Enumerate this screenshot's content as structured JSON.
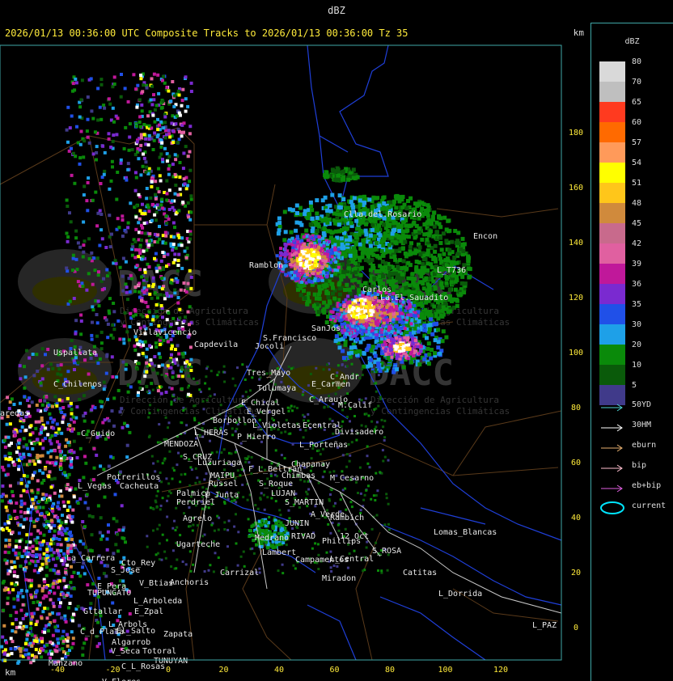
{
  "window_title": "dBZ",
  "headline": "2026/01/13 00:36:00 UTC Composite Tracks to 2026/01/13 00:36:00 Tz 35",
  "unit_label": "km",
  "legend": {
    "title": "dBZ",
    "scale": [
      {
        "value": "80",
        "color": "#d9d9d9"
      },
      {
        "value": "70",
        "color": "#bfbfbf"
      },
      {
        "value": "65",
        "color": "#ff3a1f"
      },
      {
        "value": "60",
        "color": "#ff6a00"
      },
      {
        "value": "57",
        "color": "#ff9a5a"
      },
      {
        "value": "54",
        "color": "#ffff00"
      },
      {
        "value": "51",
        "color": "#ffc61a"
      },
      {
        "value": "48",
        "color": "#d08a3c"
      },
      {
        "value": "45",
        "color": "#c86a8c"
      },
      {
        "value": "42",
        "color": "#e060a0"
      },
      {
        "value": "39",
        "color": "#c0189a"
      },
      {
        "value": "36",
        "color": "#7a2ad0"
      },
      {
        "value": "35",
        "color": "#2050e8"
      },
      {
        "value": "30",
        "color": "#1ea0e8"
      },
      {
        "value": "20",
        "color": "#0a8a0a"
      },
      {
        "value": "10",
        "color": "#0a5a0a"
      },
      {
        "value": "5",
        "color": "#403a8a"
      }
    ],
    "tracks": [
      {
        "label": "50YD",
        "color": "#4fd3d3"
      },
      {
        "label": "30HM",
        "color": "#ffffff"
      },
      {
        "label": "eburn",
        "color": "#e8b070"
      },
      {
        "label": "bip",
        "color": "#ffc0d0"
      },
      {
        "label": "eb+bip",
        "color": "#e060e0"
      },
      {
        "label": "current",
        "color": "#00e5ff",
        "icon": "ellipse"
      }
    ]
  },
  "map": {
    "y_ticks": [
      "180",
      "160",
      "140",
      "120",
      "100",
      "80",
      "60",
      "40",
      "20",
      "0"
    ],
    "x_ticks": [
      "-40",
      "-20",
      "0",
      "20",
      "40",
      "60",
      "80",
      "100",
      "120"
    ],
    "watermark": {
      "brand": "DACC",
      "line1": "Dirección de Agricultura",
      "line2": "y Contingencias Climáticas"
    },
    "places": [
      "Clla.del.Rosario",
      "Encon",
      "Ramblon",
      "L_T736",
      "Carlos",
      "La.El.Sauadito",
      "S.Francisco",
      "Villavicencio",
      "Capdevila",
      "Jocoli",
      "SanJos",
      "Uspallata",
      "Tres_Mayo",
      "Tulumaya",
      "C_Andr",
      "E_Carmen",
      "C_Chilenos",
      "E_Chical",
      "E_Vergel",
      "C_Araujo",
      "M.Calif",
      "Borbollon",
      "Ecentral",
      "Divisadero",
      "aredas",
      "C_Guido",
      "L_HERAS",
      "P_Hierro",
      "L_Violetas",
      "MENDOZA",
      "L_Porteñas",
      "S_CRUZ",
      "Luzuriaga",
      "F_L_Beltran",
      "Chapanay",
      "Potrerillos",
      "MAIPU",
      "Chimbas",
      "M_Cesarno",
      "L_Vegas",
      "Cacheuta",
      "Russel",
      "S_Roque",
      "LUJAN",
      "Palmica",
      "Perdriel",
      "L_Junta",
      "S_MARTIN",
      "A_Verde",
      "Agrelo",
      "JUNIN",
      "Rambich",
      "Lomas_Blancas",
      "Ugarteche",
      "RIVAD",
      "12_Oct",
      "La_Carrera",
      "Cto_Rey",
      "S_Jose",
      "Phillips",
      "S_ROSA",
      "Carrizal",
      "Medrano",
      "Catitas",
      "L_Central",
      "E_Pera",
      "Anchoris",
      "V_Btias",
      "TUPUNGATO",
      "Miradon",
      "L_Arboleda",
      "L_Dorrida",
      "Gltallar",
      "E_Zpal",
      "L_Arbols",
      "C_d_Plata",
      "Zapata",
      "L_PAZ",
      "Algarrob",
      "V_Seca",
      "Totoral",
      "Manzano",
      "TUNUYAN",
      "C_L_Rosas",
      "V_Flores",
      "El_Salto",
      "Campamentos",
      "Lambert"
    ]
  }
}
